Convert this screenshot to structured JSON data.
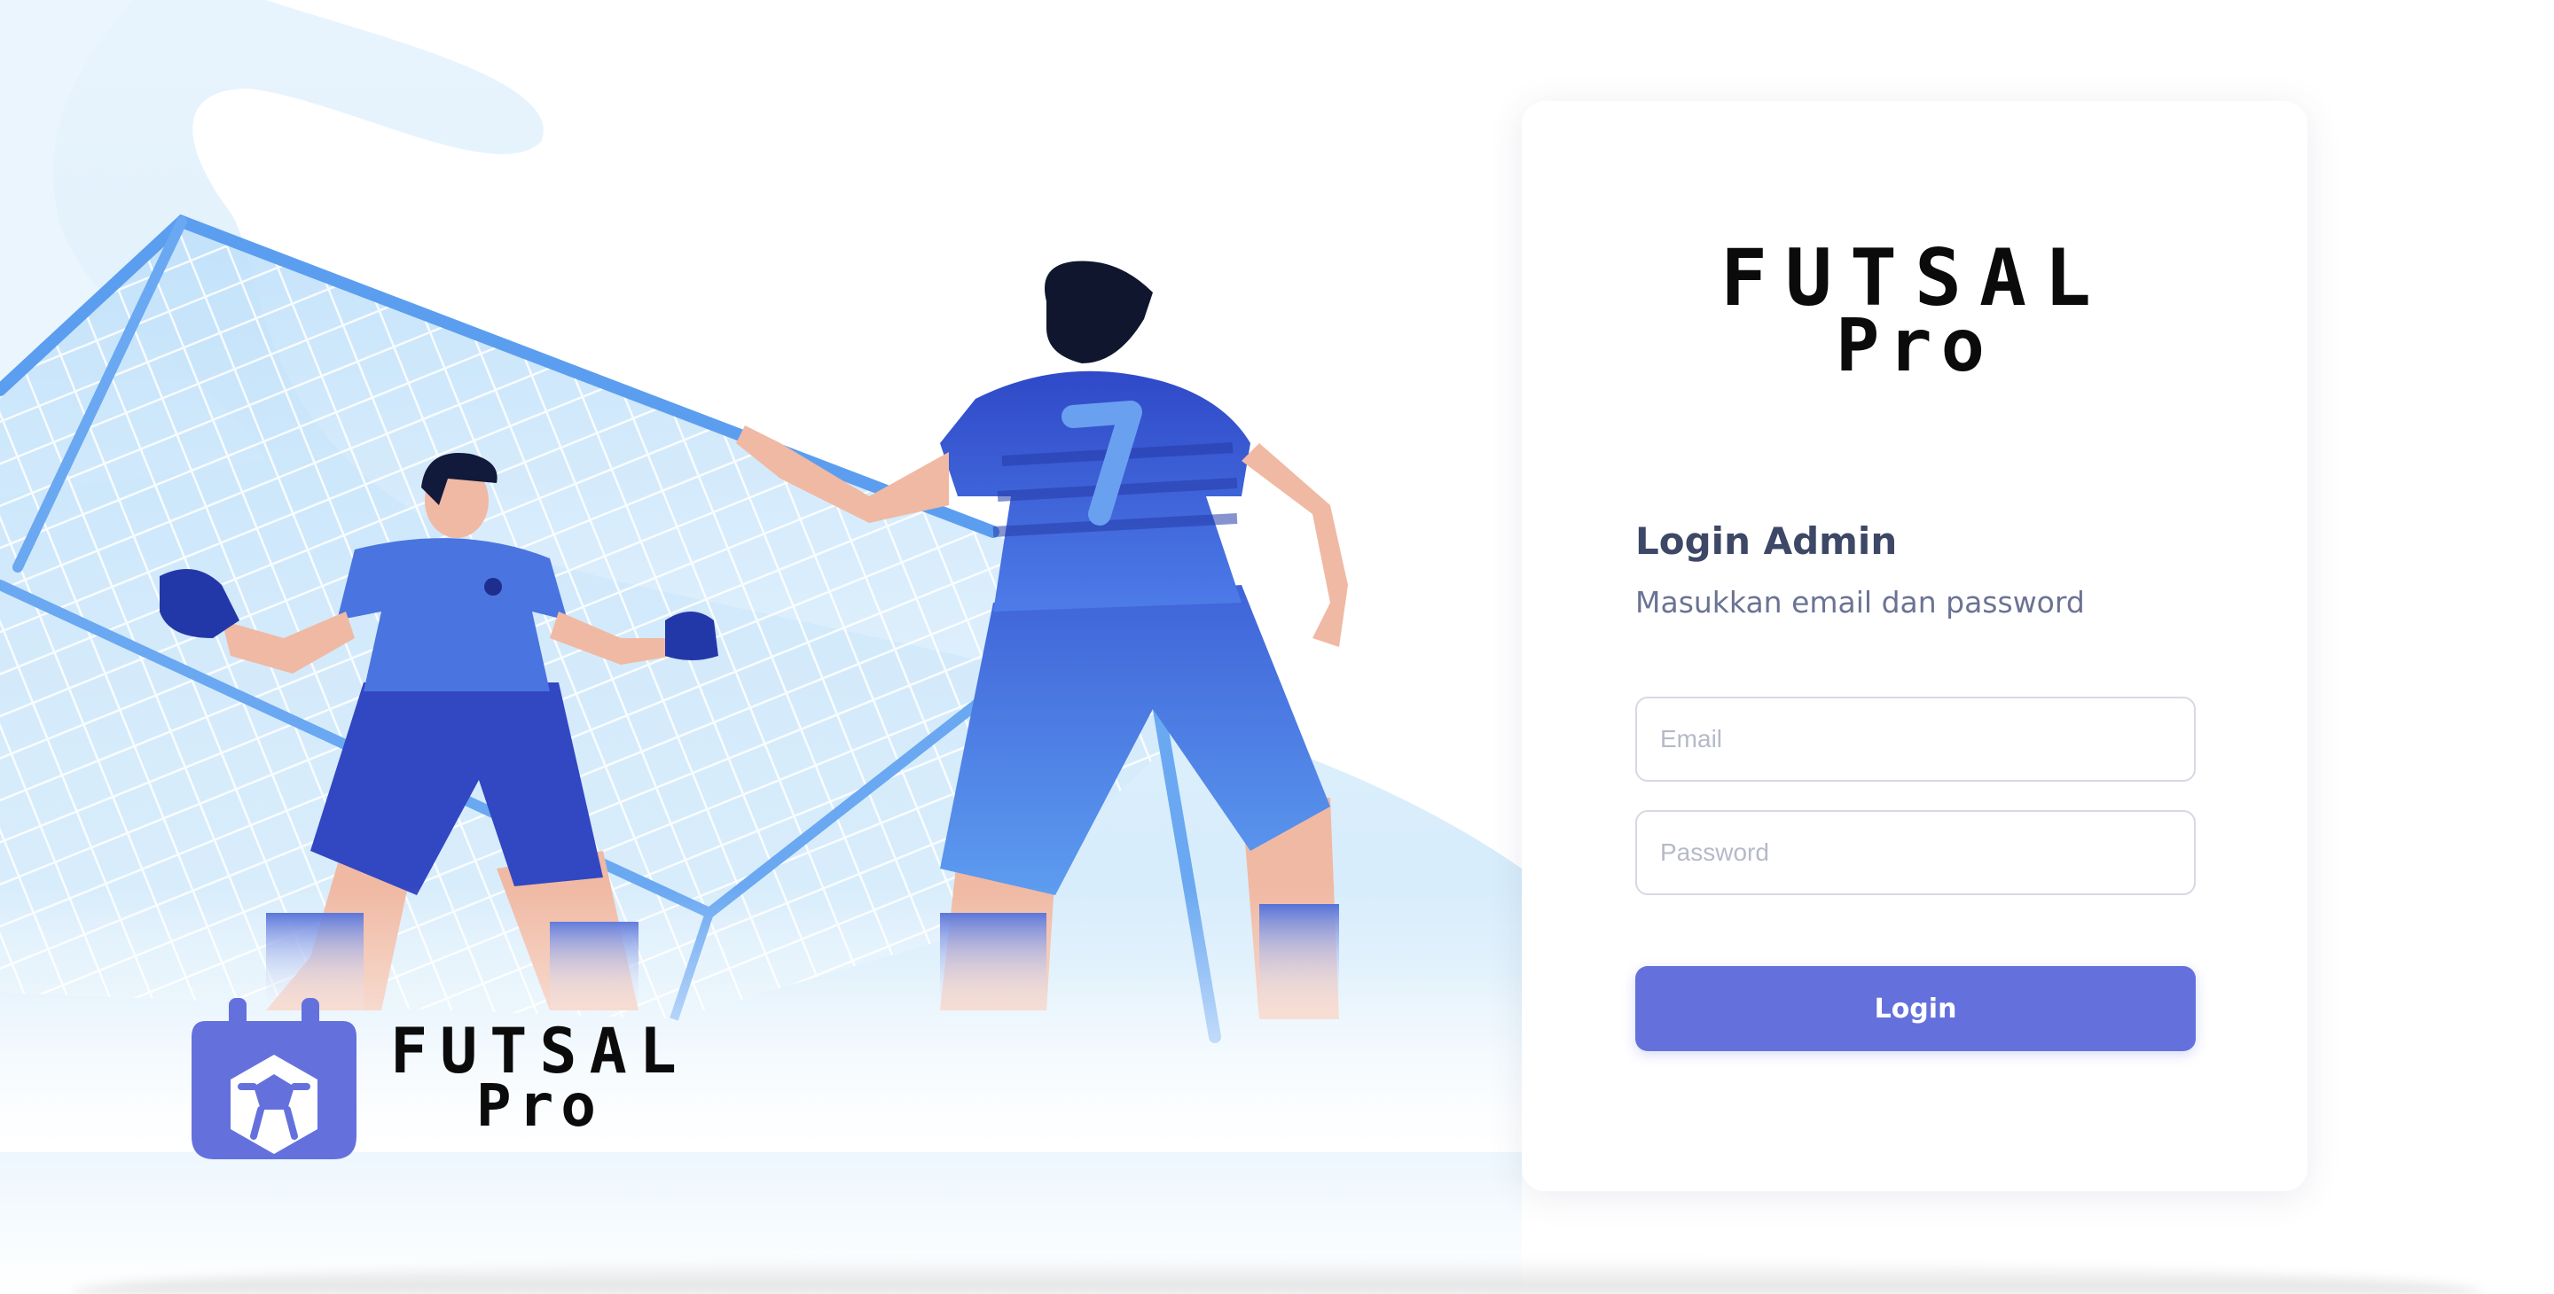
{
  "brand": {
    "line1": "FUTSAL",
    "line2": "Pro"
  },
  "login": {
    "title": "Login Admin",
    "subtitle": "Masukkan email dan password",
    "email_placeholder": "Email",
    "password_placeholder": "Password",
    "submit_label": "Login"
  },
  "hero": {
    "jersey_number": "7"
  },
  "colors": {
    "accent": "#6471dd",
    "title_text": "#3d4766",
    "subtitle_text": "#6b7394",
    "field_border": "#d7d9e2",
    "jersey_blue": "#3456d8",
    "net_blue": "#5b9ef0"
  },
  "icons": {
    "brand_badge": "futsal-ball-calendar-icon"
  }
}
